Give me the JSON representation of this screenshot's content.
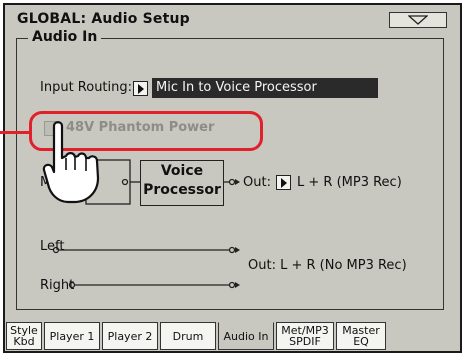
{
  "header": {
    "title": "GLOBAL: Audio Setup"
  },
  "panel": {
    "title": "Audio In"
  },
  "routing": {
    "label": "Input Routing:",
    "value": "Mic In to Voice Processor"
  },
  "phantom": {
    "label": "48V Phantom Power",
    "checked": false
  },
  "diagram": {
    "mic_label": "Mic",
    "vp_line1": "Voice",
    "vp_line2": "Processor",
    "out_label": "Out:",
    "out_value": "L + R (MP3 Rec)",
    "left_label": "Left",
    "right_label": "Right",
    "out_direct": "Out: L + R (No MP3 Rec)"
  },
  "tabs": [
    {
      "line1": "Style",
      "line2": "Kbd"
    },
    {
      "line1": "Player 1",
      "line2": ""
    },
    {
      "line1": "Player 2",
      "line2": ""
    },
    {
      "line1": "Drum",
      "line2": ""
    },
    {
      "line1": "Audio In",
      "line2": "",
      "active": true
    },
    {
      "line1": "Met/MP3",
      "line2": "SPDIF"
    },
    {
      "line1": "Master",
      "line2": "EQ"
    }
  ],
  "colors": {
    "highlight": "#e0202a",
    "screen": "#c8c7c0"
  }
}
